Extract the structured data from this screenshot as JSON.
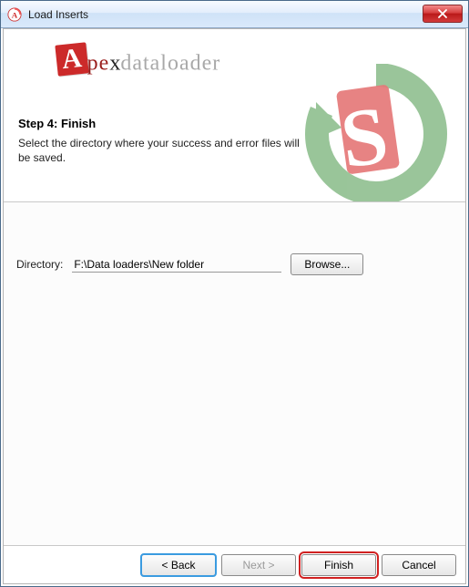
{
  "window": {
    "title": "Load Inserts",
    "icon_name": "apex-app-icon"
  },
  "logo": {
    "boxed_letter": "A",
    "pre_x": "pe",
    "x": "x",
    "post_x": "dataloader"
  },
  "step": {
    "title": "Step 4: Finish",
    "description": "Select the directory where your success and error files will be saved."
  },
  "directory": {
    "label": "Directory:",
    "value": "F:\\Data loaders\\New folder",
    "browse_label": "Browse..."
  },
  "nav": {
    "back": "< Back",
    "next": "Next >",
    "finish": "Finish",
    "cancel": "Cancel"
  }
}
